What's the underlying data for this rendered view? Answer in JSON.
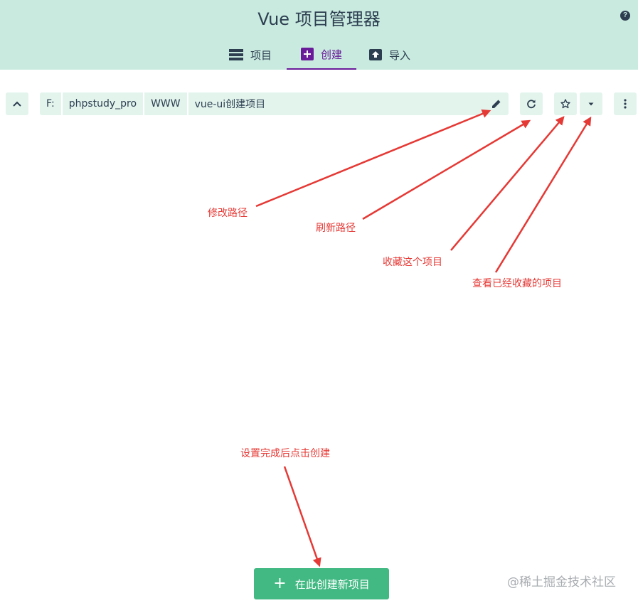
{
  "header": {
    "title": "Vue 项目管理器",
    "help_icon": "question-circle-icon",
    "tabs": [
      {
        "label": "项目",
        "icon": "list-icon",
        "active": false
      },
      {
        "label": "创建",
        "icon": "plus-box-icon",
        "active": true
      },
      {
        "label": "导入",
        "icon": "upload-icon",
        "active": false
      }
    ]
  },
  "path_bar": {
    "crumbs": [
      "F:",
      "phpstudy_pro",
      "WWW",
      "vue-ui创建项目"
    ],
    "icons": {
      "up": "chevron-up-icon",
      "edit": "pencil-icon",
      "refresh": "refresh-icon",
      "favorite": "star-outline-icon",
      "favorites_dropdown": "caret-down-icon",
      "more": "more-vertical-icon"
    }
  },
  "annotations": {
    "edit_path": "修改路径",
    "refresh_path": "刷新路径",
    "favorite_project": "收藏这个项目",
    "view_favorites": "查看已经收藏的项目",
    "click_create": "设置完成后点击创建"
  },
  "create_button": {
    "label": "在此创建新项目"
  },
  "watermark": "@稀土掘金技术社区",
  "colors": {
    "header_bg": "#c9eadf",
    "accent_purple": "#6a1b9a",
    "button_green": "#42b983",
    "annotation_red": "#e53935",
    "crumb_bg": "#e3f4ed"
  }
}
